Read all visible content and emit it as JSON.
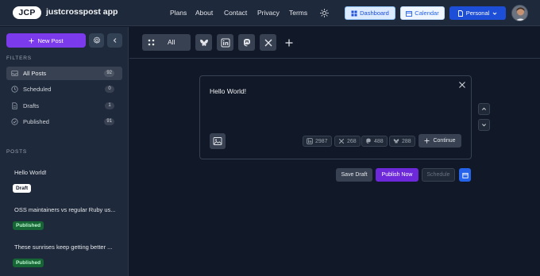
{
  "header": {
    "logo_text": "JCP",
    "app_name": "justcrosspost app",
    "nav": [
      "Plans",
      "About",
      "Contact",
      "Privacy",
      "Terms"
    ],
    "theme_icon": "sun-icon",
    "dashboard_label": "Dashboard",
    "calendar_label": "Calendar",
    "workspace_label": "Personal",
    "colors": {
      "dashboard_bg": "#dbeafe",
      "calendar_bg": "#eff6ff",
      "workspace_bg": "#1d4ed8"
    }
  },
  "sidebar": {
    "new_post_label": "New Post",
    "settings_icon": "gear-icon",
    "collapse_icon": "chevron-left-icon",
    "filters_heading": "FILTERS",
    "filters": [
      {
        "label": "All Posts",
        "count": "92",
        "icon": "inbox-icon"
      },
      {
        "label": "Scheduled",
        "count": "0",
        "icon": "clock-icon"
      },
      {
        "label": "Drafts",
        "count": "1",
        "icon": "document-icon"
      },
      {
        "label": "Published",
        "count": "91",
        "icon": "check-circle-icon"
      }
    ],
    "posts_heading": "POSTS",
    "posts": [
      {
        "title": "Hello World!",
        "status": "Draft"
      },
      {
        "title": "OSS maintainers vs regular Ruby us...",
        "status": "Published"
      },
      {
        "title": "These sunrises keep getting better ...",
        "status": "Published"
      }
    ]
  },
  "tabs": {
    "all_label": "All",
    "networks": [
      "bluesky-icon",
      "linkedin-icon",
      "mastodon-icon",
      "x-icon"
    ],
    "add_icon": "plus-icon"
  },
  "editor": {
    "text": "Hello World!",
    "counts": {
      "linkedin": "2987",
      "x": "268",
      "mastodon": "488",
      "bluesky": "288"
    },
    "continue_label": "Continue"
  },
  "actions": {
    "save_draft": "Save Draft",
    "publish_now": "Publish Now",
    "schedule": "Schedule"
  },
  "colors": {
    "accent": "#7c3aed",
    "background": "#111827",
    "sidebar": "#1e293b",
    "published_badge": "#166534"
  }
}
